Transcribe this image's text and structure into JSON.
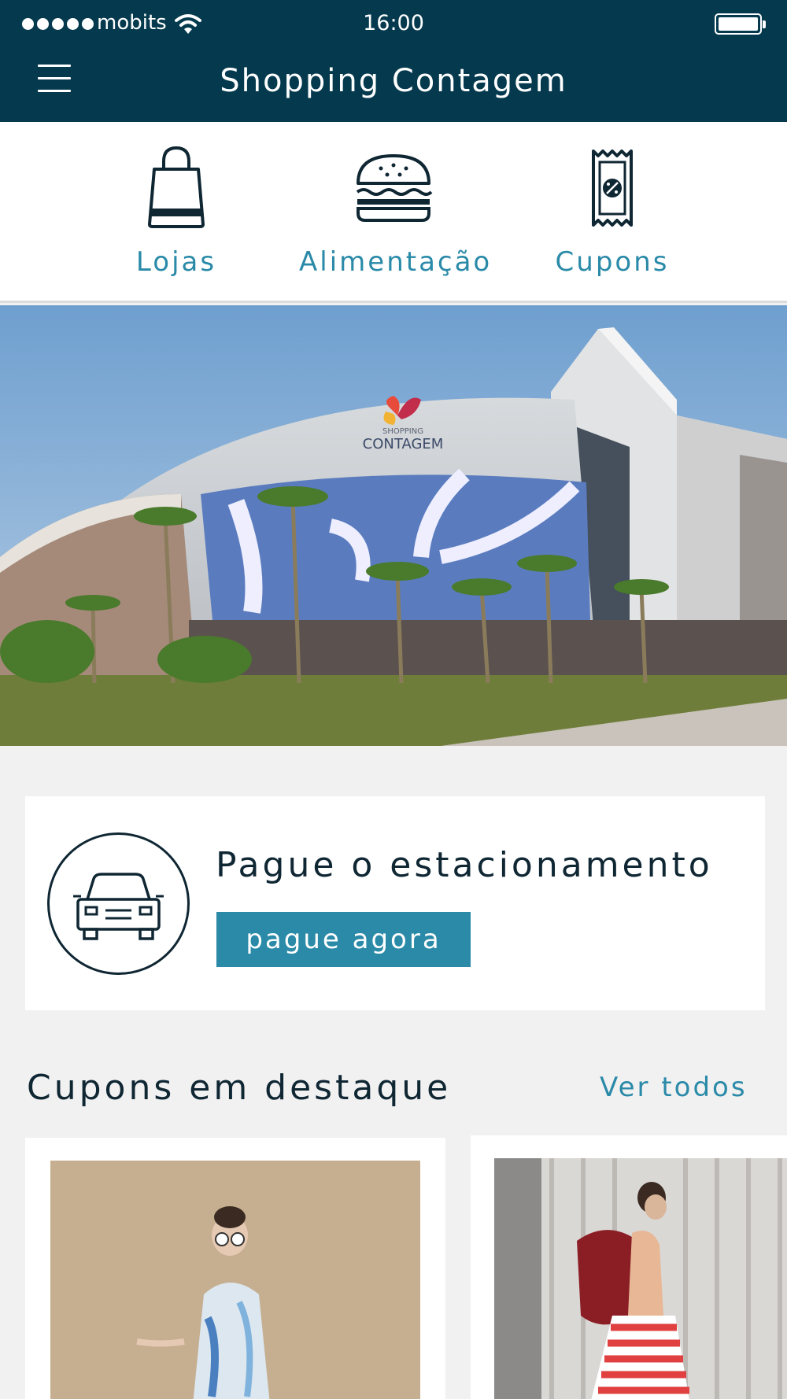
{
  "status_bar": {
    "carrier": "mobits",
    "time": "16:00"
  },
  "header": {
    "title": "Shopping Contagem",
    "menu_icon": "hamburger-menu-icon"
  },
  "categories": [
    {
      "label": "Lojas",
      "icon": "shopping-bag-icon"
    },
    {
      "label": "Alimentação",
      "icon": "burger-icon"
    },
    {
      "label": "Cupons",
      "icon": "coupon-ticket-icon"
    }
  ],
  "hero": {
    "logo_small": "SHOPPING",
    "logo_text": "CONTAGEM"
  },
  "parking": {
    "title": "Pague o estacionamento",
    "button_label": "pague agora",
    "icon": "car-icon"
  },
  "coupons": {
    "section_title": "Cupons em destaque",
    "see_all_label": "Ver todos"
  },
  "colors": {
    "header_bg": "#053a4e",
    "accent": "#2a8aa8",
    "text_dark": "#0f2633",
    "page_bg": "#f1f1f1"
  }
}
